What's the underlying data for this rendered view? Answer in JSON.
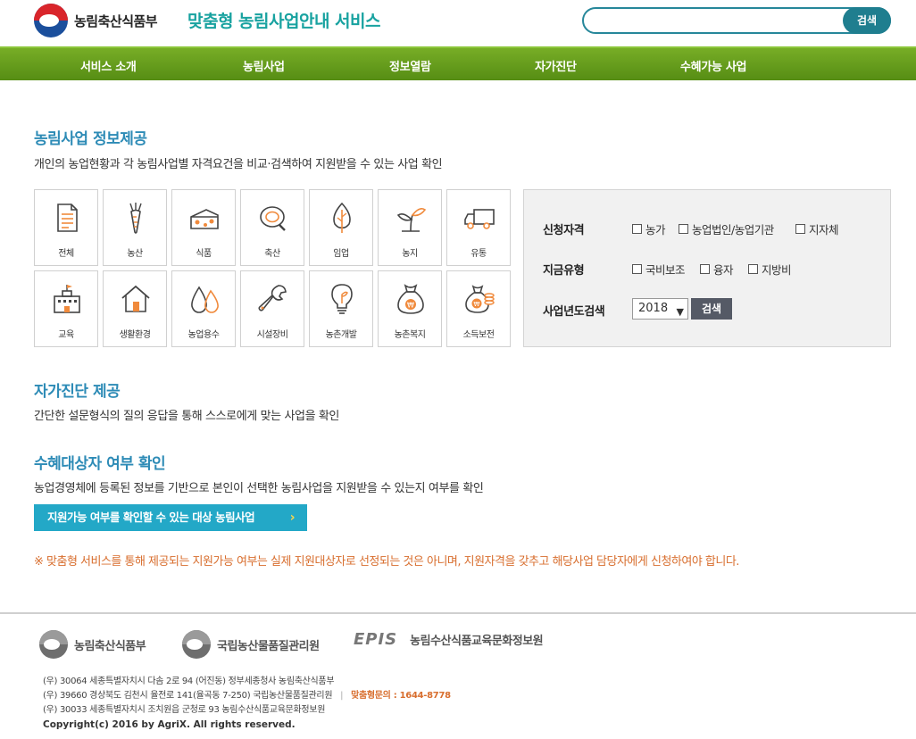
{
  "header": {
    "logo_text": "농림축산식품부",
    "service_title": "맞춤형 농림사업안내 서비스",
    "search": {
      "value": "",
      "placeholder": "",
      "button_label": "검색"
    }
  },
  "nav": {
    "items": [
      "서비스 소개",
      "농림사업",
      "정보열람",
      "자가진단",
      "수혜가능 사업"
    ]
  },
  "info_section": {
    "title": "농림사업 정보제공",
    "description": "개인의 농업현황과 각 농림사업별 자격요건을 비교·검색하여 지원받을 수 있는 사업 확인"
  },
  "categories": [
    {
      "label": "전체",
      "icon": "document-icon"
    },
    {
      "label": "농산",
      "icon": "carrot-icon"
    },
    {
      "label": "식품",
      "icon": "cheese-icon"
    },
    {
      "label": "축산",
      "icon": "meat-icon"
    },
    {
      "label": "임업",
      "icon": "tree-icon"
    },
    {
      "label": "농지",
      "icon": "sprout-icon"
    },
    {
      "label": "유통",
      "icon": "truck-icon"
    },
    {
      "label": "교육",
      "icon": "school-icon"
    },
    {
      "label": "생활환경",
      "icon": "house-icon"
    },
    {
      "label": "농업용수",
      "icon": "water-drops-icon"
    },
    {
      "label": "시설장비",
      "icon": "wrench-icon"
    },
    {
      "label": "농촌개발",
      "icon": "lightbulb-icon"
    },
    {
      "label": "농촌복지",
      "icon": "money-bag-icon"
    },
    {
      "label": "소득보전",
      "icon": "coins-icon"
    }
  ],
  "filter": {
    "eligibility": {
      "label": "신청자격",
      "options": [
        "농가",
        "농업법인/농업기관",
        "지자체"
      ]
    },
    "fund_type": {
      "label": "지금유형",
      "options": [
        "국비보조",
        "융자",
        "지방비"
      ]
    },
    "year": {
      "label": "사업년도검색",
      "selected": "2018",
      "button_label": "검색"
    }
  },
  "self_diagnosis": {
    "title": "자가진단 제공",
    "description": "간단한 설문형식의 질의 응답을 통해 스스로에게 맞는 사업을 확인"
  },
  "beneficiary": {
    "title": "수혜대상자 여부 확인",
    "description": "농업경영체에 등록된 정보를 기반으로 본인이 선택한 농림사업을 지원받을 수 있는지 여부를 확인",
    "cta_label": "지원가능 여부를 확인할 수 있는 대상 농림사업",
    "notice": "※ 맞춤형 서비스를 통해 제공되는 지원가능 여부는 실제 지원대상자로 선정되는 것은 아니며, 지원자격을 갖추고 해당사업 담당자에게 신청하여야 합니다."
  },
  "footer": {
    "logos": [
      "농림축산식품부",
      "국립농산물품질관리원",
      "농림수산식품교육문화정보원"
    ],
    "epis_text": "EPIS",
    "addresses": [
      "(우) 30064 세종특별자치시 다솜 2로 94 (어진동) 정부세종청사 농림축산식품부",
      "(우) 39660 경상북도 김천시 율전로 141(율곡동 7-250) 국립농산물품질관리원",
      "(우) 30033 세종특별자치시 조치원읍 군청로 93 농림수산식품교육문화정보원"
    ],
    "separator": "|",
    "hotline": "맞춤형문의 : 1644-8778",
    "copyright": "Copyright(c) 2016 by AgriX. All rights reserved."
  },
  "colors": {
    "nav_green": "#6aa11f",
    "title_teal": "#18a2a0",
    "heading_blue": "#2d8bb6",
    "cta_blue": "#23a8c7",
    "notice_orange": "#d86e2e",
    "icon_orange": "#f08a3c"
  }
}
